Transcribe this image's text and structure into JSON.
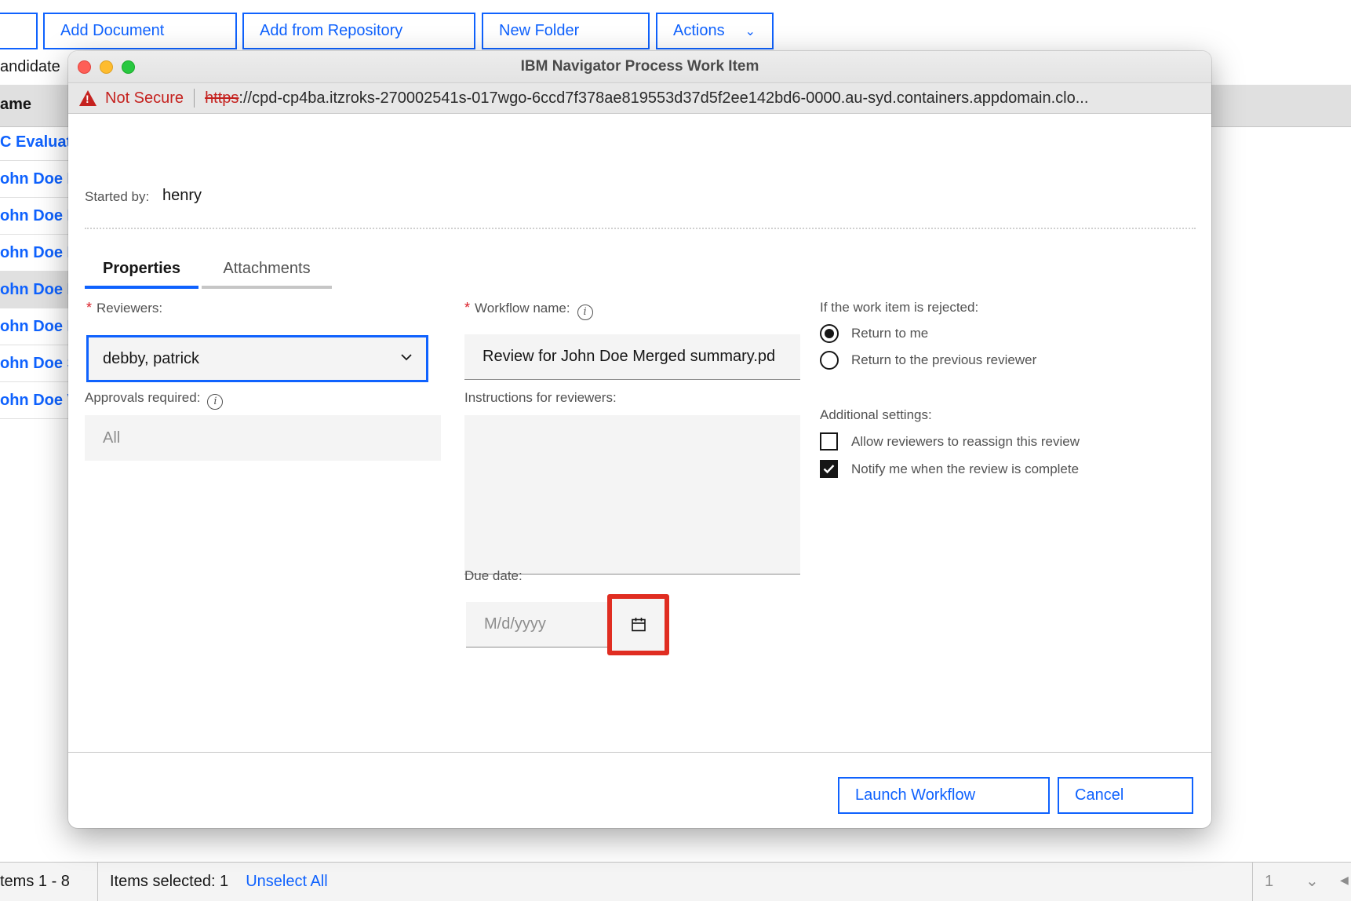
{
  "background": {
    "toolbar": {
      "add_document": "Add Document",
      "add_from_repository": "Add from Repository",
      "new_folder": "New Folder",
      "actions": "Actions"
    },
    "candidate_label": "andidate",
    "column_header": "ame",
    "rows": [
      "C Evaluat",
      "ohn Doe D",
      "ohn Doe D",
      "ohn Doe E",
      "ohn Doe M",
      "ohn Doe F",
      "ohn Doe S",
      "ohn Doe V"
    ],
    "status": {
      "items_range": "tems 1 - 8",
      "items_selected": "Items selected: 1",
      "unselect_all": "Unselect All",
      "page_number": "1"
    }
  },
  "window": {
    "title": "IBM Navigator Process Work Item",
    "url": {
      "warning": "Not Secure",
      "scheme": "https",
      "rest": "://cpd-cp4ba.itzroks-270002541s-017wgo-6ccd7f378ae819553d37d5f2ee142bd6-0000.au-syd.containers.appdomain.clo..."
    }
  },
  "form": {
    "started_by_label": "Started by:",
    "started_by_value": "henry",
    "tabs": {
      "properties": "Properties",
      "attachments": "Attachments"
    },
    "reviewers": {
      "required_mark": "*",
      "label": "Reviewers:",
      "value": "debby, patrick"
    },
    "approvals": {
      "label": "Approvals required:",
      "value": "All"
    },
    "workflow_name": {
      "required_mark": "*",
      "label": "Workflow name:",
      "value": "Review for John Doe Merged summary.pd"
    },
    "instructions": {
      "label": "Instructions for reviewers:",
      "value": ""
    },
    "due_date": {
      "label": "Due date:",
      "placeholder": "M/d/yyyy"
    },
    "rejected": {
      "label": "If the work item is rejected:",
      "option_return_to_me": "Return to me",
      "option_previous_reviewer": "Return to the previous reviewer",
      "selected": "Return to me"
    },
    "additional": {
      "label": "Additional settings:",
      "allow_reassign": "Allow reviewers to reassign this review",
      "allow_reassign_checked": false,
      "notify_complete": "Notify me when the review is complete",
      "notify_complete_checked": true
    },
    "buttons": {
      "launch": "Launch Workflow",
      "cancel": "Cancel"
    }
  },
  "colors": {
    "accent": "#0f62fe",
    "highlight": "#e02d21",
    "warning": "#c5221f"
  }
}
